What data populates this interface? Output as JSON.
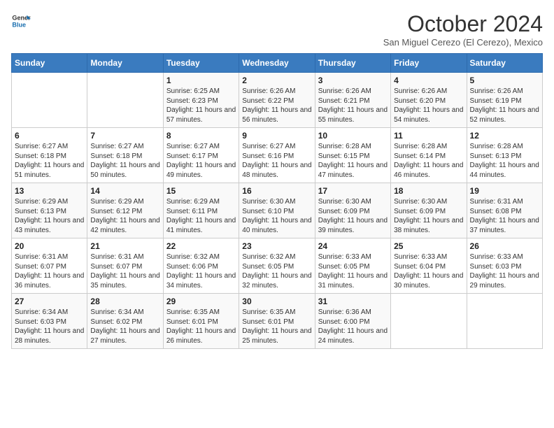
{
  "logo": {
    "line1": "General",
    "line2": "Blue"
  },
  "title": "October 2024",
  "subtitle": "San Miguel Cerezo (El Cerezo), Mexico",
  "days_of_week": [
    "Sunday",
    "Monday",
    "Tuesday",
    "Wednesday",
    "Thursday",
    "Friday",
    "Saturday"
  ],
  "weeks": [
    [
      {
        "day": "",
        "info": ""
      },
      {
        "day": "",
        "info": ""
      },
      {
        "day": "1",
        "info": "Sunrise: 6:25 AM\nSunset: 6:23 PM\nDaylight: 11 hours and 57 minutes."
      },
      {
        "day": "2",
        "info": "Sunrise: 6:26 AM\nSunset: 6:22 PM\nDaylight: 11 hours and 56 minutes."
      },
      {
        "day": "3",
        "info": "Sunrise: 6:26 AM\nSunset: 6:21 PM\nDaylight: 11 hours and 55 minutes."
      },
      {
        "day": "4",
        "info": "Sunrise: 6:26 AM\nSunset: 6:20 PM\nDaylight: 11 hours and 54 minutes."
      },
      {
        "day": "5",
        "info": "Sunrise: 6:26 AM\nSunset: 6:19 PM\nDaylight: 11 hours and 52 minutes."
      }
    ],
    [
      {
        "day": "6",
        "info": "Sunrise: 6:27 AM\nSunset: 6:18 PM\nDaylight: 11 hours and 51 minutes."
      },
      {
        "day": "7",
        "info": "Sunrise: 6:27 AM\nSunset: 6:18 PM\nDaylight: 11 hours and 50 minutes."
      },
      {
        "day": "8",
        "info": "Sunrise: 6:27 AM\nSunset: 6:17 PM\nDaylight: 11 hours and 49 minutes."
      },
      {
        "day": "9",
        "info": "Sunrise: 6:27 AM\nSunset: 6:16 PM\nDaylight: 11 hours and 48 minutes."
      },
      {
        "day": "10",
        "info": "Sunrise: 6:28 AM\nSunset: 6:15 PM\nDaylight: 11 hours and 47 minutes."
      },
      {
        "day": "11",
        "info": "Sunrise: 6:28 AM\nSunset: 6:14 PM\nDaylight: 11 hours and 46 minutes."
      },
      {
        "day": "12",
        "info": "Sunrise: 6:28 AM\nSunset: 6:13 PM\nDaylight: 11 hours and 44 minutes."
      }
    ],
    [
      {
        "day": "13",
        "info": "Sunrise: 6:29 AM\nSunset: 6:13 PM\nDaylight: 11 hours and 43 minutes."
      },
      {
        "day": "14",
        "info": "Sunrise: 6:29 AM\nSunset: 6:12 PM\nDaylight: 11 hours and 42 minutes."
      },
      {
        "day": "15",
        "info": "Sunrise: 6:29 AM\nSunset: 6:11 PM\nDaylight: 11 hours and 41 minutes."
      },
      {
        "day": "16",
        "info": "Sunrise: 6:30 AM\nSunset: 6:10 PM\nDaylight: 11 hours and 40 minutes."
      },
      {
        "day": "17",
        "info": "Sunrise: 6:30 AM\nSunset: 6:09 PM\nDaylight: 11 hours and 39 minutes."
      },
      {
        "day": "18",
        "info": "Sunrise: 6:30 AM\nSunset: 6:09 PM\nDaylight: 11 hours and 38 minutes."
      },
      {
        "day": "19",
        "info": "Sunrise: 6:31 AM\nSunset: 6:08 PM\nDaylight: 11 hours and 37 minutes."
      }
    ],
    [
      {
        "day": "20",
        "info": "Sunrise: 6:31 AM\nSunset: 6:07 PM\nDaylight: 11 hours and 36 minutes."
      },
      {
        "day": "21",
        "info": "Sunrise: 6:31 AM\nSunset: 6:07 PM\nDaylight: 11 hours and 35 minutes."
      },
      {
        "day": "22",
        "info": "Sunrise: 6:32 AM\nSunset: 6:06 PM\nDaylight: 11 hours and 34 minutes."
      },
      {
        "day": "23",
        "info": "Sunrise: 6:32 AM\nSunset: 6:05 PM\nDaylight: 11 hours and 32 minutes."
      },
      {
        "day": "24",
        "info": "Sunrise: 6:33 AM\nSunset: 6:05 PM\nDaylight: 11 hours and 31 minutes."
      },
      {
        "day": "25",
        "info": "Sunrise: 6:33 AM\nSunset: 6:04 PM\nDaylight: 11 hours and 30 minutes."
      },
      {
        "day": "26",
        "info": "Sunrise: 6:33 AM\nSunset: 6:03 PM\nDaylight: 11 hours and 29 minutes."
      }
    ],
    [
      {
        "day": "27",
        "info": "Sunrise: 6:34 AM\nSunset: 6:03 PM\nDaylight: 11 hours and 28 minutes."
      },
      {
        "day": "28",
        "info": "Sunrise: 6:34 AM\nSunset: 6:02 PM\nDaylight: 11 hours and 27 minutes."
      },
      {
        "day": "29",
        "info": "Sunrise: 6:35 AM\nSunset: 6:01 PM\nDaylight: 11 hours and 26 minutes."
      },
      {
        "day": "30",
        "info": "Sunrise: 6:35 AM\nSunset: 6:01 PM\nDaylight: 11 hours and 25 minutes."
      },
      {
        "day": "31",
        "info": "Sunrise: 6:36 AM\nSunset: 6:00 PM\nDaylight: 11 hours and 24 minutes."
      },
      {
        "day": "",
        "info": ""
      },
      {
        "day": "",
        "info": ""
      }
    ]
  ]
}
